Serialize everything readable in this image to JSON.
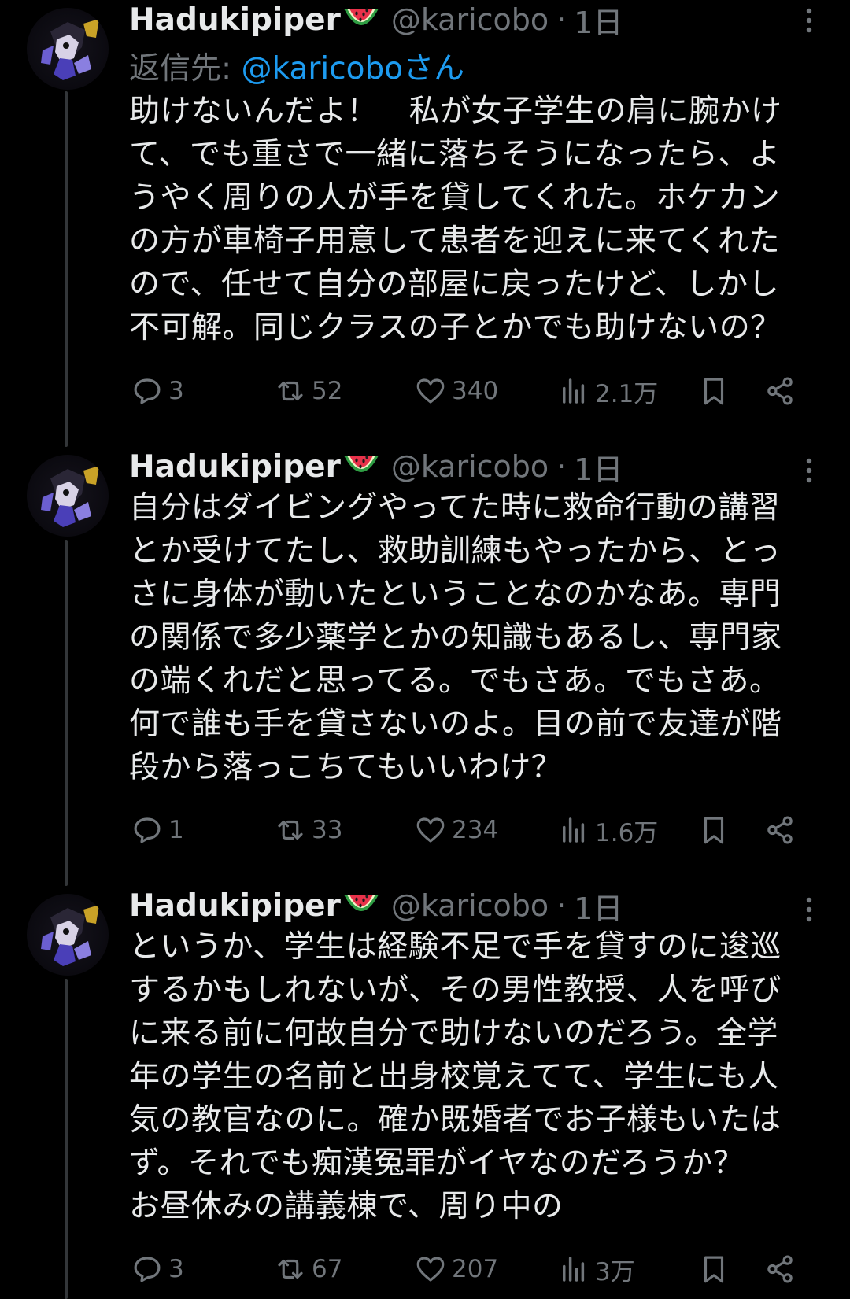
{
  "colors": {
    "background": "#000000",
    "text": "#e7e9ea",
    "muted": "#71767b",
    "mention": "#1d9bf0",
    "thread_line": "#333639"
  },
  "tweets": [
    {
      "name": "Hadukipiper",
      "name_emoji": "watermelon-icon",
      "handle": "@karicobo",
      "dot": "·",
      "time": "1日",
      "reply_prefix": "返信先: ",
      "reply_mention": "@karicoboさん",
      "text": "助けないんだよ！　私が女子学生の肩に腕かけ\nて、でも重さで一緒に落ちそうになったら、よ\nうやく周りの人が手を貸してくれた。ホケカン\nの方が車椅子用意して患者を迎えに来てくれた\nので、任せて自分の部屋に戻ったけど、しかし\n不可解。同じクラスの子とかでも助けないの？",
      "replies": "3",
      "retweets": "52",
      "likes": "340",
      "views": "2.1万"
    },
    {
      "name": "Hadukipiper",
      "name_emoji": "watermelon-icon",
      "handle": "@karicobo",
      "dot": "·",
      "time": "1日",
      "text": "自分はダイビングやってた時に救命行動の講習\nとか受けてたし、救助訓練もやったから、とっ\nさに身体が動いたということなのかなあ。専門\nの関係で多少薬学とかの知識もあるし、専門家\nの端くれだと思ってる。でもさあ。でもさあ。\n何で誰も手を貸さないのよ。目の前で友達が階\n段から落っこちてもいいわけ？",
      "replies": "1",
      "retweets": "33",
      "likes": "234",
      "views": "1.6万"
    },
    {
      "name": "Hadukipiper",
      "name_emoji": "watermelon-icon",
      "handle": "@karicobo",
      "dot": "·",
      "time": "1日",
      "text": "というか、学生は経験不足で手を貸すのに逡巡\nするかもしれないが、その男性教授、人を呼び\nに来る前に何故自分で助けないのだろう。全学\n年の学生の名前と出身校覚えてて、学生にも人\n気の教官なのに。確か既婚者でお子様もいたは\nず。それでも痴漢冤罪がイヤなのだろうか？\nお昼休みの講義棟で、周り中の",
      "replies": "3",
      "retweets": "67",
      "likes": "207",
      "views": "3万"
    }
  ]
}
